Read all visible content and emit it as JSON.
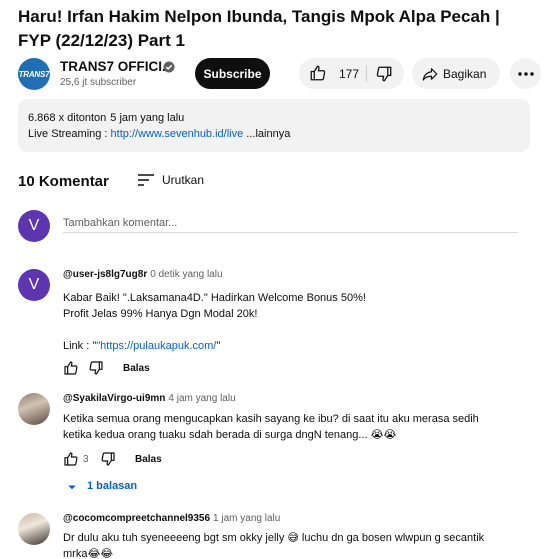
{
  "video": {
    "title": "Haru! Irfan Hakim Nelpon Ibunda, Tangis Mpok Alpa Pecah | FYP (22/12/23) Part 1"
  },
  "channel": {
    "logo_text": "TRANS7",
    "name": "TRANS7 OFFICI...",
    "subscribers": "25,6 jt subscriber",
    "subscribe_label": "Subscribe"
  },
  "actions": {
    "like_count": "177",
    "share_label": "Bagikan"
  },
  "description": {
    "views": "6.868 x ditonton",
    "age": "5 jam yang lalu",
    "line_prefix": "Live Streaming : ",
    "link": "http://www.sevenhub.id/live",
    "more": " ...lainnya"
  },
  "comments_section": {
    "count_label": "10 Komentar",
    "sort_label": "Urutkan",
    "user_initial": "V",
    "add_placeholder": "Tambahkan komentar..."
  },
  "comments": [
    {
      "initial": "V",
      "author": "@user-js8lg7ug8r",
      "time": "0 detik yang lalu",
      "line1": "Kabar Baik! \".Laksamana4D.\" Hadirkan Welcome Bonus 50%!",
      "line2": "Profit Jelas 99% Hanya Dgn Modal 20k!",
      "link_prefix": "Link  : \"",
      "link": "\"https://pulaukapuk.com/",
      "link_suffix": "\"",
      "like_count": "",
      "reply_label": "Balas"
    },
    {
      "author": "@SyakilaVirgo-ui9mn",
      "time": "4 jam yang lalu",
      "line1": "Ketika semua orang mengucapkan kasih sayang ke ibu? di saat itu aku merasa sedih",
      "line2": "ketika kedua orang tuaku sdah berada di surga dngN tenang... 😭😭",
      "like_count": "3",
      "reply_label": "Balas",
      "replies_label": "1 balasan"
    },
    {
      "author": "@cocomcompreetchannel9356",
      "time": "1 jam yang lalu",
      "line1": "Dr dulu aku tuh syeneeeeng bgt sm okky jelly 😅 luchu dn ga bosen wlwpun g secantik",
      "line2": "mrka😂😂"
    }
  ]
}
